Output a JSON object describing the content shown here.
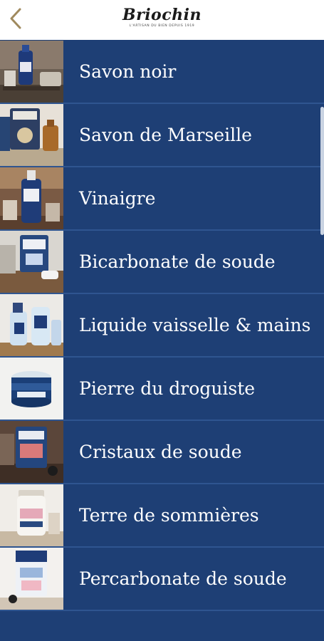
{
  "header": {
    "brand": "Briochin",
    "tagline": "L'ARTISAN DU BIEN DEPUIS 1919"
  },
  "colors": {
    "row_background": "#1e3f75",
    "divider": "#2f5590",
    "header_background": "#ffffff",
    "back_arrow": "#a08a5e"
  },
  "icons": {
    "back": "chevron-left-icon"
  },
  "products": [
    {
      "label": "Savon noir"
    },
    {
      "label": "Savon de Marseille"
    },
    {
      "label": "Vinaigre"
    },
    {
      "label": "Bicarbonate de soude"
    },
    {
      "label": "Liquide vaisselle & mains"
    },
    {
      "label": "Pierre du droguiste"
    },
    {
      "label": "Cristaux de soude"
    },
    {
      "label": "Terre de sommières"
    },
    {
      "label": "Percarbonate de soude"
    }
  ]
}
